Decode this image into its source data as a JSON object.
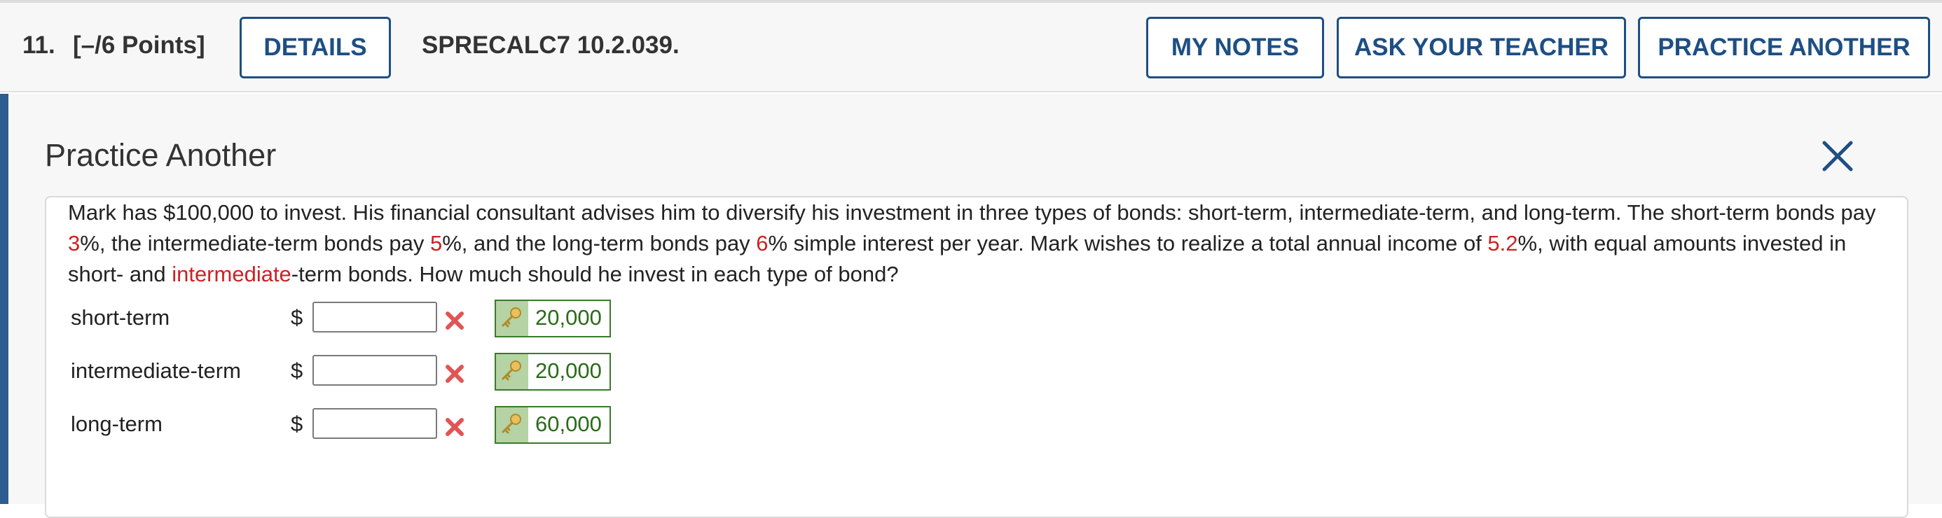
{
  "header": {
    "question_number": "11.",
    "points": "[–/6 Points]",
    "details_label": "DETAILS",
    "question_id": "SPRECALC7 10.2.039.",
    "my_notes_label": "MY NOTES",
    "ask_teacher_label": "ASK YOUR TEACHER",
    "practice_another_label": "PRACTICE ANOTHER"
  },
  "panel": {
    "title": "Practice Another",
    "problem": {
      "seg1": "Mark has $100,000 to invest. His financial consultant advises him to diversify his investment in three types of bonds: short-term, intermediate-term, and long-term. The short-term bonds pay ",
      "rate1": "3",
      "seg2": "%, the intermediate-term bonds pay ",
      "rate2": "5",
      "seg3": "%, and the long-term bonds pay ",
      "rate3": "6",
      "seg4": "% simple interest per year. Mark wishes to realize a total annual income of ",
      "rate4": "5.2",
      "seg5": "%, with equal amounts invested in short- and ",
      "word": "intermediate",
      "seg6": "-term bonds. How much should he invest in each type of bond?"
    },
    "rows": [
      {
        "label": "short-term",
        "currency": "$",
        "value": "",
        "answer": "20,000"
      },
      {
        "label": "intermediate-term",
        "currency": "$",
        "value": "",
        "answer": "20,000"
      },
      {
        "label": "long-term",
        "currency": "$",
        "value": "",
        "answer": "60,000"
      }
    ]
  },
  "colors": {
    "accent": "#2d5c8e",
    "button_border": "#1d4f84",
    "highlight_red": "#cc2222",
    "answer_green": "#2a6a1a",
    "incorrect_red": "#e05555"
  },
  "icons": {
    "close": "close-icon",
    "incorrect": "incorrect-x-icon",
    "key": "key-icon"
  }
}
